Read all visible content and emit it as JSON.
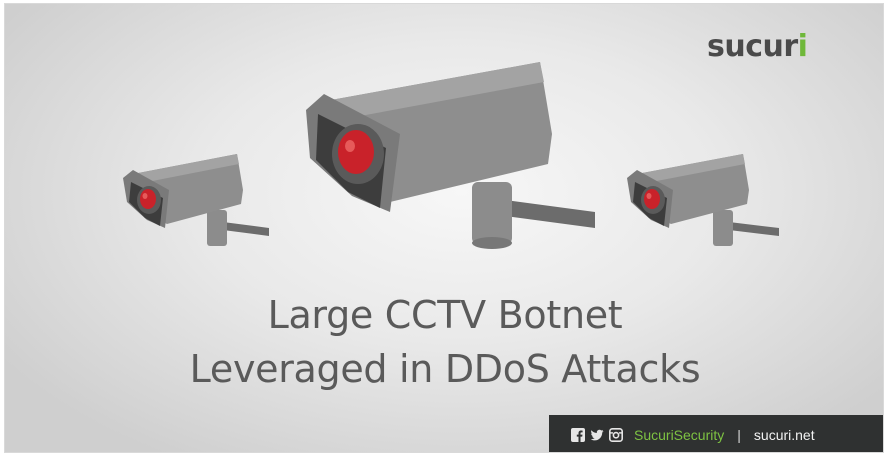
{
  "brand": {
    "logo_main": "sucur",
    "logo_accent": "i"
  },
  "headline": {
    "line1": "Large CCTV Botnet",
    "line2": "Leveraged in DDoS Attacks"
  },
  "footer": {
    "social_icons": [
      "facebook-icon",
      "twitter-icon",
      "instagram-icon"
    ],
    "handle": "SucuriSecurity",
    "separator": "|",
    "website": "sucuri.net"
  },
  "colors": {
    "brand_green": "#7dc242",
    "camera_body": "#8a8a8a",
    "camera_lens": "#d12a2a",
    "footer_bg": "#2f3131",
    "headline_text": "#5a5a5a"
  },
  "illustration": {
    "cameras": [
      "security-camera-left",
      "security-camera-center",
      "security-camera-right"
    ]
  }
}
